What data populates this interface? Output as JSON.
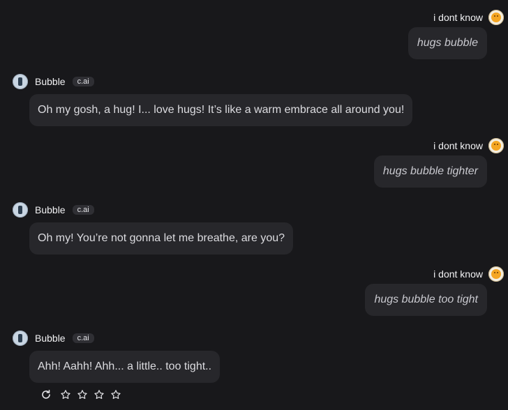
{
  "user": {
    "name": "i dont know"
  },
  "bot": {
    "name": "Bubble",
    "badge": "c.ai"
  },
  "messages": [
    {
      "role": "user",
      "text": "hugs bubble"
    },
    {
      "role": "bot",
      "text": "Oh my gosh, a hug! I... love hugs! It’s like a warm embrace all around you!"
    },
    {
      "role": "user",
      "text": "hugs bubble tighter"
    },
    {
      "role": "bot",
      "text": "Oh my! You’re not gonna let me breathe, are you?"
    },
    {
      "role": "user",
      "text": "hugs bubble too tight"
    },
    {
      "role": "bot",
      "text": "Ahh! Aahh! Ahh... a little.. too tight.."
    }
  ],
  "rating": {
    "max_stars": 4,
    "value": 0
  },
  "icons": {
    "regenerate": "refresh-icon",
    "star": "star-outline-icon"
  },
  "colors": {
    "background": "#18181b",
    "bubble": "#27272b"
  }
}
